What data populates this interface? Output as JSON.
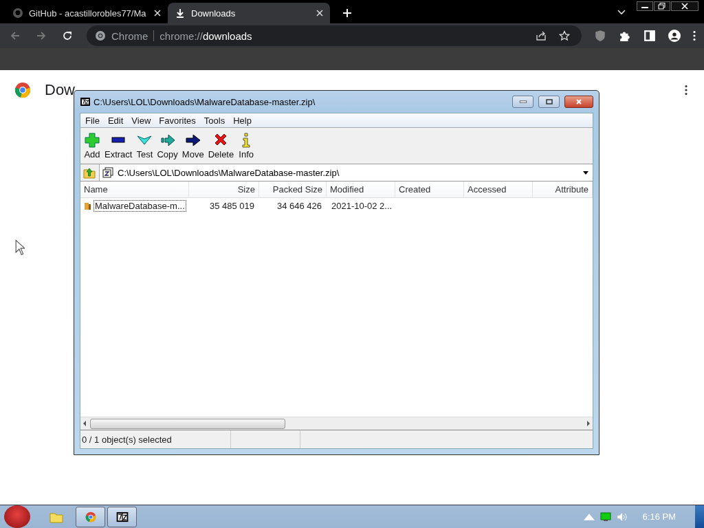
{
  "browser": {
    "tabs": [
      {
        "title": "GitHub - acastillorobles77/Ma",
        "selected": false,
        "kind": "github"
      },
      {
        "title": "Downloads",
        "selected": true,
        "kind": "download"
      }
    ],
    "address": {
      "site": "Chrome",
      "scheme": "chrome://",
      "host": "downloads"
    }
  },
  "page": {
    "title": "Dow"
  },
  "archive_window": {
    "title": "C:\\Users\\LOL\\Downloads\\MalwareDatabase-master.zip\\",
    "menu": [
      "File",
      "Edit",
      "View",
      "Favorites",
      "Tools",
      "Help"
    ],
    "toolbar": [
      {
        "label": "Add",
        "kind": "add"
      },
      {
        "label": "Extract",
        "kind": "extract"
      },
      {
        "label": "Test",
        "kind": "test"
      },
      {
        "label": "Copy",
        "kind": "copy"
      },
      {
        "label": "Move",
        "kind": "move"
      },
      {
        "label": "Delete",
        "kind": "delete"
      },
      {
        "label": "Info",
        "kind": "info"
      }
    ],
    "path": "C:\\Users\\LOL\\Downloads\\MalwareDatabase-master.zip\\",
    "columns": [
      "Name",
      "Size",
      "Packed Size",
      "Modified",
      "Created",
      "Accessed",
      "Attribute"
    ],
    "rows": [
      {
        "cells": [
          "MalwareDatabase-m...",
          "35 485 019",
          "34 646 426",
          "2021-10-02 2..."
        ],
        "focused": true
      }
    ],
    "status": "0 / 1 object(s) selected"
  },
  "taskbar": {
    "clock": "6:16 PM"
  }
}
